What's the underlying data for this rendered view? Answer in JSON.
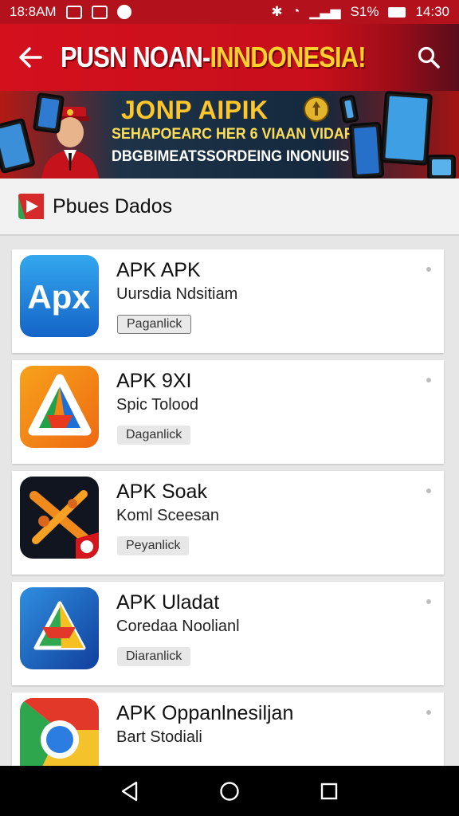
{
  "status_bar": {
    "time": "18:8AM",
    "battery": "S1%",
    "clock_right": "14:30"
  },
  "app_bar": {
    "title_main": "PUSN NOAN-",
    "title_highlight": "INNDONESIA!"
  },
  "banner": {
    "headline": "JONP AIPIK",
    "line2": "SEHAPOEARC HER 6 VIAAN VIDARIKA",
    "line3": "DBGBIMEATSSORDEING INONUIIS"
  },
  "section": {
    "title": "Pbues Dados"
  },
  "apps": [
    {
      "name": "APK APK",
      "subtitle": "Uursdia Ndsitiam",
      "button": "Paganlick",
      "icon": "apx-icon"
    },
    {
      "name": "APK 9XI",
      "subtitle": "Spic Tolood",
      "button": "Daganlick",
      "icon": "triangle-logo-icon"
    },
    {
      "name": "APK Soak",
      "subtitle": "Koml Sceesan",
      "button": "Peyanlick",
      "icon": "crossed-swords-icon"
    },
    {
      "name": "APK Uladat",
      "subtitle": "Coredaa Noolianl",
      "button": "Diaranlick",
      "icon": "map-triangle-icon"
    },
    {
      "name": "APK Oppanlnesiljan",
      "subtitle": "Bart Stodiali",
      "button": "",
      "icon": "chrome-like-icon"
    }
  ],
  "colors": {
    "app_bar": "#d4101d",
    "title_highlight": "#ffd12a",
    "banner_dark": "#14293e"
  }
}
